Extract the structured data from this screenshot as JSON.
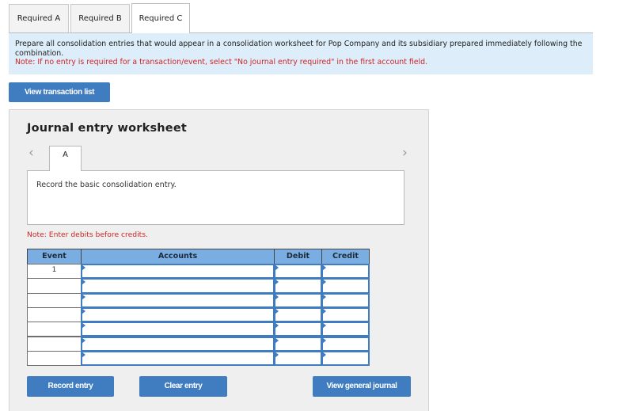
{
  "tabs": [
    {
      "label": "Required A",
      "active": false
    },
    {
      "label": "Required B",
      "active": false
    },
    {
      "label": "Required C",
      "active": true
    }
  ],
  "instructions": {
    "text": "Prepare all consolidation entries that would appear in a consolidation worksheet for Pop Company and its subsidiary prepared immediately following the combination.",
    "note": "Note: If no entry is required for a transaction/event, select \"No journal entry required\" in the first account field."
  },
  "view_transaction_list_label": "View transaction list",
  "worksheet": {
    "title": "Journal entry worksheet",
    "prev_icon": "chevron-left-icon",
    "next_icon": "chevron-right-icon",
    "entry_tab_label": "A",
    "description": "Record the basic consolidation entry.",
    "note": "Note: Enter debits before credits.",
    "columns": [
      "Event",
      "Accounts",
      "Debit",
      "Credit"
    ],
    "rows": [
      {
        "event": "1",
        "account": "",
        "debit": "",
        "credit": ""
      },
      {
        "event": "",
        "account": "",
        "debit": "",
        "credit": ""
      },
      {
        "event": "",
        "account": "",
        "debit": "",
        "credit": ""
      },
      {
        "event": "",
        "account": "",
        "debit": "",
        "credit": ""
      },
      {
        "event": "",
        "account": "",
        "debit": "",
        "credit": ""
      },
      {
        "event": "",
        "account": "",
        "debit": "",
        "credit": ""
      },
      {
        "event": "",
        "account": "",
        "debit": "",
        "credit": ""
      }
    ],
    "buttons": {
      "record": "Record entry",
      "clear": "Clear entry",
      "view_journal": "View general journal"
    }
  },
  "colors": {
    "button_blue": "#3f7cc0",
    "header_blue": "#7aaee2",
    "banner_bg": "#ddeefa",
    "note_red": "#d02525"
  }
}
